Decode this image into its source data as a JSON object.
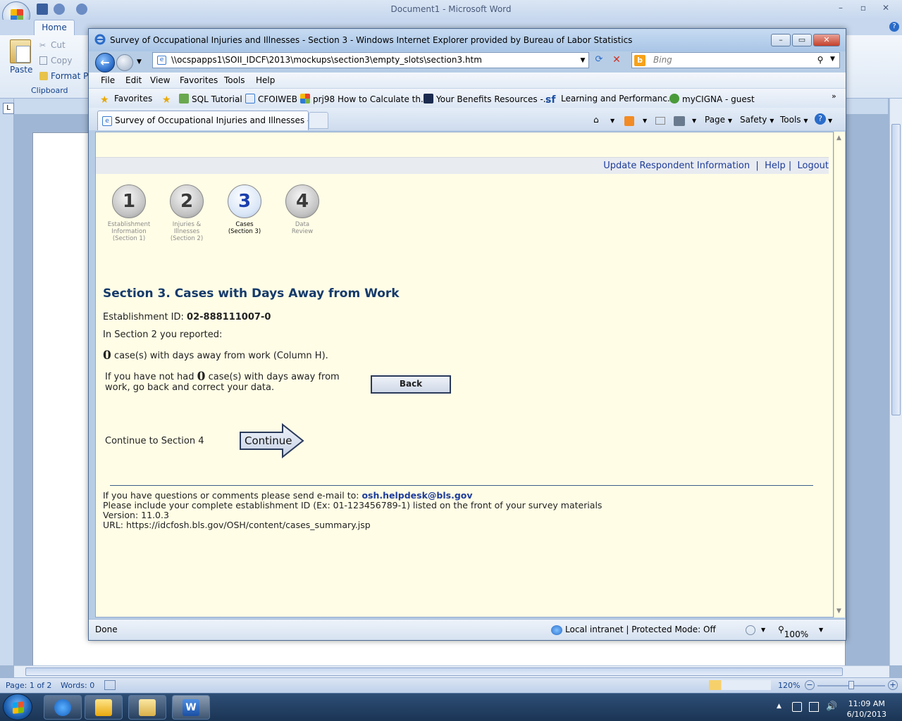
{
  "word": {
    "title": "Document1 - Microsoft Word",
    "tab_home": "Home",
    "paste_label": "Paste",
    "cut_label": "Cut",
    "copy_label": "Copy",
    "format_painter_label": "Format Pai",
    "clipboard_label": "Clipboard",
    "status_page": "Page: 1 of 2",
    "status_words": "Words: 0",
    "zoom": "120%"
  },
  "ie": {
    "title": "Survey of Occupational Injuries and Illnesses - Section 3 - Windows Internet Explorer provided by Bureau of Labor Statistics",
    "address": "\\\\ocspapps1\\SOII_IDCF\\2013\\mockups\\section3\\empty_slots\\section3.htm",
    "search_placeholder": "Bing",
    "menu": [
      "File",
      "Edit",
      "View",
      "Favorites",
      "Tools",
      "Help"
    ],
    "favorites_label": "Favorites",
    "favorites": [
      "SQL Tutorial",
      "CFOIWEB",
      "prj98 How to Calculate th...",
      "Your Benefits Resources -...",
      "Learning and Performanc...",
      "myCIGNA - guest"
    ],
    "tab_title": "Survey of Occupational Injuries and Illnesses - Se...",
    "cmd_page": "Page",
    "cmd_safety": "Safety",
    "cmd_tools": "Tools",
    "status_done": "Done",
    "status_zone": "Local intranet | Protected Mode: Off",
    "status_zoom": "100%"
  },
  "page": {
    "links": [
      "Update Respondent Information",
      "Help",
      "Logout"
    ],
    "steps": [
      {
        "num": "1",
        "line1": "Establishment",
        "line2": "Information",
        "line3": "(Section 1)"
      },
      {
        "num": "2",
        "line1": "Injuries &",
        "line2": "Illnesses",
        "line3": "(Section 2)"
      },
      {
        "num": "3",
        "line1": "Cases",
        "line2": "(Section 3)",
        "line3": ""
      },
      {
        "num": "4",
        "line1": "Data",
        "line2": "Review",
        "line3": ""
      }
    ],
    "heading": "Section 3. Cases with Days Away from Work",
    "est_label": "Establishment ID:",
    "est_id": "02-888111007-0",
    "reported": "In Section 2 you reported:",
    "cases_count": "0",
    "cases_text": "case(s) with days away from work (Column H).",
    "notice_a": "If you have not had",
    "notice_count": "0",
    "notice_b": "case(s) with days away from",
    "notice_c": "work, go back and correct your data.",
    "back_label": "Back",
    "continue_text": "Continue to Section 4",
    "continue_label": "Continue",
    "footer_q": "If you have questions or comments please send e-mail to:",
    "footer_email": "osh.helpdesk@bls.gov",
    "footer_include": "Please include your complete establishment ID (Ex: 01-123456789-1) listed on the front of your survey materials",
    "footer_version": "Version: 11.0.3",
    "footer_url": "URL: https://idcfosh.bls.gov/OSH/content/cases_summary.jsp"
  },
  "taskbar": {
    "time": "11:09 AM",
    "date": "6/10/2013"
  }
}
